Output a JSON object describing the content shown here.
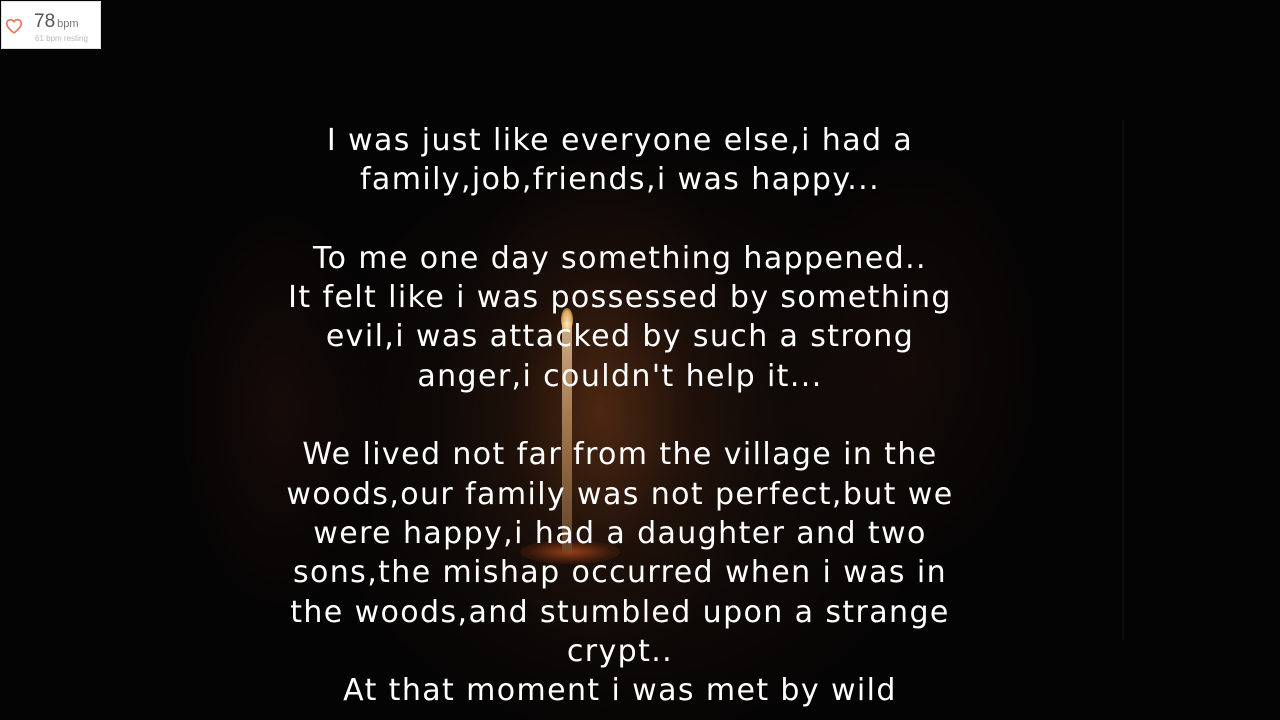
{
  "heart_rate": {
    "value": "78",
    "unit": "bpm",
    "resting": "61 bpm resting",
    "icon": "heart-outline-icon",
    "icon_color": "#e8735a"
  },
  "story": {
    "paragraphs": [
      [
        "I was just like everyone else,i had a",
        "family,job,friends,i was happy..."
      ],
      [
        "To me one day something happened..",
        "It felt like i was possessed by something",
        "evil,i was attacked by such a strong",
        "anger,i couldn't help it..."
      ],
      [
        "We lived not far from the village in the",
        "woods,our family was not perfect,but we",
        "were happy,i had a daughter and two",
        "sons,the mishap occurred when i was in",
        "the woods,and stumbled upon a strange",
        "crypt..",
        "At that moment i was met by wild"
      ]
    ]
  },
  "colors": {
    "text": "#ffffff",
    "background": "#050404"
  }
}
